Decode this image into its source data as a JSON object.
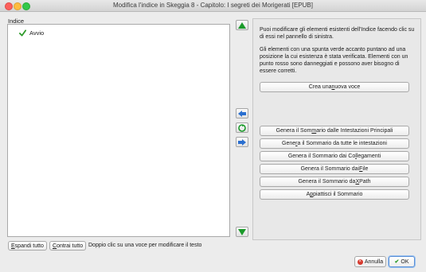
{
  "window": {
    "title": "Modifica l'indice in Skeggia 8 - Capitolo: I segreti dei Morigerati [EPUB]"
  },
  "tree": {
    "label": "Indice",
    "items": [
      {
        "label": "Avvio",
        "status": "verified-green-check"
      }
    ]
  },
  "side_controls": {
    "move_up_icon": "green-up-arrow-icon",
    "move_down_icon": "green-down-arrow-icon",
    "indent_left_icon": "blue-left-arrow-icon",
    "recycle_icon": "green-recycle-icon",
    "indent_right_icon": "blue-right-arrow-icon"
  },
  "info": {
    "paragraph1": "Puoi modificare gli elementi esistenti dell'Indice facendo clic su di essi nel pannello di sinistra.",
    "paragraph2": "Gli elementi con una spunta verde accanto puntano ad una posizione la cui esistenza è stata verificata. Elementi con un punto rosso sono danneggiati e possono aver bisogno di essere corretti."
  },
  "buttons": {
    "new_entry": {
      "pre": "Crea una ",
      "u": "n",
      "post": "uova voce"
    },
    "from_headings": {
      "pre": "Genera il Som",
      "u": "m",
      "post": "ario dalle Intestazioni Principali"
    },
    "from_all_headings": {
      "pre": "Gene",
      "u": "r",
      "post": "a il Sommario da tutte le intestazioni"
    },
    "from_links": {
      "pre": "Genera il Sommario dai Co",
      "u": "l",
      "post": "legamenti"
    },
    "from_files": {
      "pre": "Genera il Sommario dai ",
      "u": "F",
      "post": "ile"
    },
    "from_xpath": {
      "pre": "Genera il Sommario da ",
      "u": "X",
      "post": "Path"
    },
    "flatten": {
      "pre": "A",
      "u": "p",
      "post": "piattisci il Sommario"
    },
    "expand_all": {
      "pre": "",
      "u": "E",
      "post": "spandi tutto"
    },
    "collapse_all": {
      "pre": "",
      "u": "C",
      "post": "ontrai tutto"
    },
    "cancel": "Annulla",
    "ok": "OK"
  },
  "hint": "Doppio clic su una voce per modificare il testo",
  "colors": {
    "check_green": "#2f9b2b",
    "arrow_green": "#1a9a2a",
    "arrow_blue": "#2a6fd0",
    "cancel_red": "#d63a2f"
  }
}
